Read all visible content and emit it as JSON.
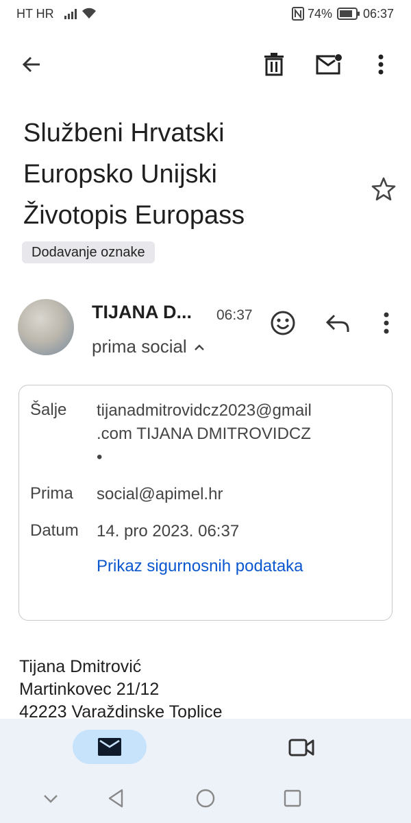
{
  "status_bar": {
    "carrier": "HT HR",
    "battery": "74%",
    "time": "06:37"
  },
  "email": {
    "subject": "Službeni Hrvatski\nEuropsko Unijski\nŽivotopis Europass",
    "label_chip": "Dodavanje oznake",
    "sender_name": "TIJANA D...",
    "time": "06:37",
    "recipient_summary": "prima social"
  },
  "details": {
    "from_label": "Šalje",
    "from_value": "tijanadmitrovidcz2023@gmail\n.com TIJANA DMITROVIDCZ\n•",
    "to_label": "Prima",
    "to_value": "social@apimel.hr",
    "date_label": "Datum",
    "date_value": "14. pro 2023. 06:37",
    "security_link": "Prikaz sigurnosnih podataka"
  },
  "body": {
    "lines": [
      "Tijana Dmitrović",
      "Martinkovec 21/12",
      "42223 Varaždinske Toplice"
    ]
  },
  "icons": {
    "back": "arrow-left-icon",
    "delete": "trash-icon",
    "mark_unread": "mail-unread-icon",
    "more": "more-vert-icon",
    "star": "star-icon",
    "emoji": "emoji-icon",
    "reply": "reply-icon",
    "mail_tab": "mail-icon",
    "meet_tab": "video-icon"
  },
  "colors": {
    "link": "#0b57d0",
    "active_tab": "#c7e3fb",
    "nav_bg": "#edf1f8"
  }
}
